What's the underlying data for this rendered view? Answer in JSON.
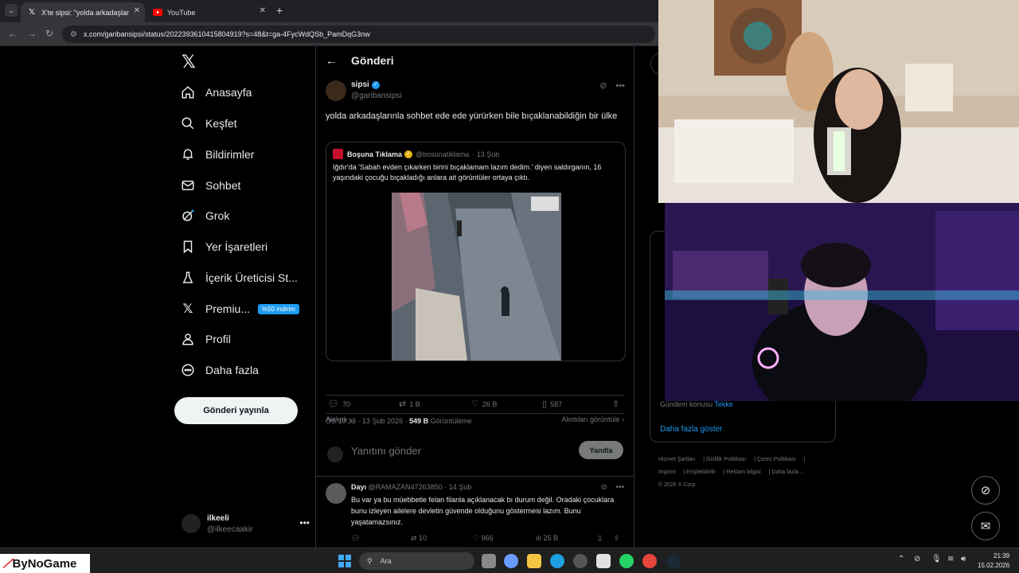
{
  "browser": {
    "tabs": [
      {
        "title": "X'te sipsi: \"yolda arkadaşlarınla",
        "active": true,
        "icon": "x-logo-icon"
      },
      {
        "title": "YouTube",
        "active": false,
        "icon": "youtube-icon"
      }
    ],
    "url": "x.com/garibansipsi/status/2022393610415804919?s=48&t=ga-4FycWdQSb_PamDqG3nw"
  },
  "nav": {
    "logo": "𝕏",
    "items": [
      {
        "label": "Anasayfa",
        "icon": "home-icon"
      },
      {
        "label": "Keşfet",
        "icon": "search-icon"
      },
      {
        "label": "Bildirimler",
        "icon": "bell-icon"
      },
      {
        "label": "Sohbet",
        "icon": "mail-icon"
      },
      {
        "label": "Grok",
        "icon": "grok-icon"
      },
      {
        "label": "Yer İşaretleri",
        "icon": "bookmark-icon"
      },
      {
        "label": "İçerik Üreticisi St...",
        "icon": "flask-icon"
      },
      {
        "label": "Premiu...",
        "icon": "x-premium-icon",
        "badge": "%50 indirim"
      },
      {
        "label": "Profil",
        "icon": "person-icon"
      },
      {
        "label": "Daha fazla",
        "icon": "more-circle-icon"
      }
    ],
    "post_button": "Gönderi yayınla",
    "account": {
      "name": "ilkeeli",
      "handle": "@ilkeecaakir"
    }
  },
  "main": {
    "title": "Gönderi",
    "tweet": {
      "name": "sipsi",
      "handle": "@garibansipsi",
      "text": "yolda arkadaşlarınla sohbet ede ede yürürken bile bıçaklanabildiğin bir ülke",
      "quote": {
        "name": "Boşuna Tıklama",
        "handle": "@bosunatiklama",
        "date": "· 13 Şub",
        "text": "Iğdır'da 'Sabah evden çıkarken birini bıçaklamam lazım dedim.' diyen saldırganın, 16 yaşındaki çocuğu bıçakladığı anlara ait görüntüler ortaya çıktı."
      },
      "time": "ÖS 10:33 · 13 Şub 2026 · ",
      "views_count": "549 B",
      "views_label": " Görüntüleme",
      "stats": {
        "replies": "70",
        "reposts": "1 B",
        "likes": "26 B",
        "bookmarks": "587"
      },
      "relevant": "Alakalı",
      "quotes_link": "Alıntıları görüntüle"
    },
    "reply_box": {
      "placeholder": "Yanıtını gönder",
      "button": "Yanıtla"
    },
    "reply": {
      "name": "Dayı",
      "handle": "@RAMAZAN47263850",
      "date": "· 14 Şub",
      "text": "Bu var ya bu müebbetle felan filanla açıklanacak bı durum değil. Oradaki çocuklara bunu izleyen ailelere devletin güvende olduğunu göstermesi lazım. Bunu yaşatamazsınız.",
      "stats": {
        "reposts": "10",
        "likes": "966",
        "views": "25 B"
      }
    }
  },
  "sidebar": {
    "trend_topic_prefix": "Gündem konusu",
    "trend_topic_link": "Tekke",
    "show_more": "Daha fazla göster",
    "footer": [
      "Hizmet Şartları",
      "Gizlilik Politikası",
      "Çerez Politikası",
      "Imprint",
      "Erişilebilirlik",
      "Reklam bilgisi",
      "Daha fazla ...",
      "© 2026 X Corp."
    ]
  },
  "taskbar": {
    "brand": "ByNoGame",
    "search": "Ara",
    "time": "21:39",
    "date": "15.02.2026"
  }
}
